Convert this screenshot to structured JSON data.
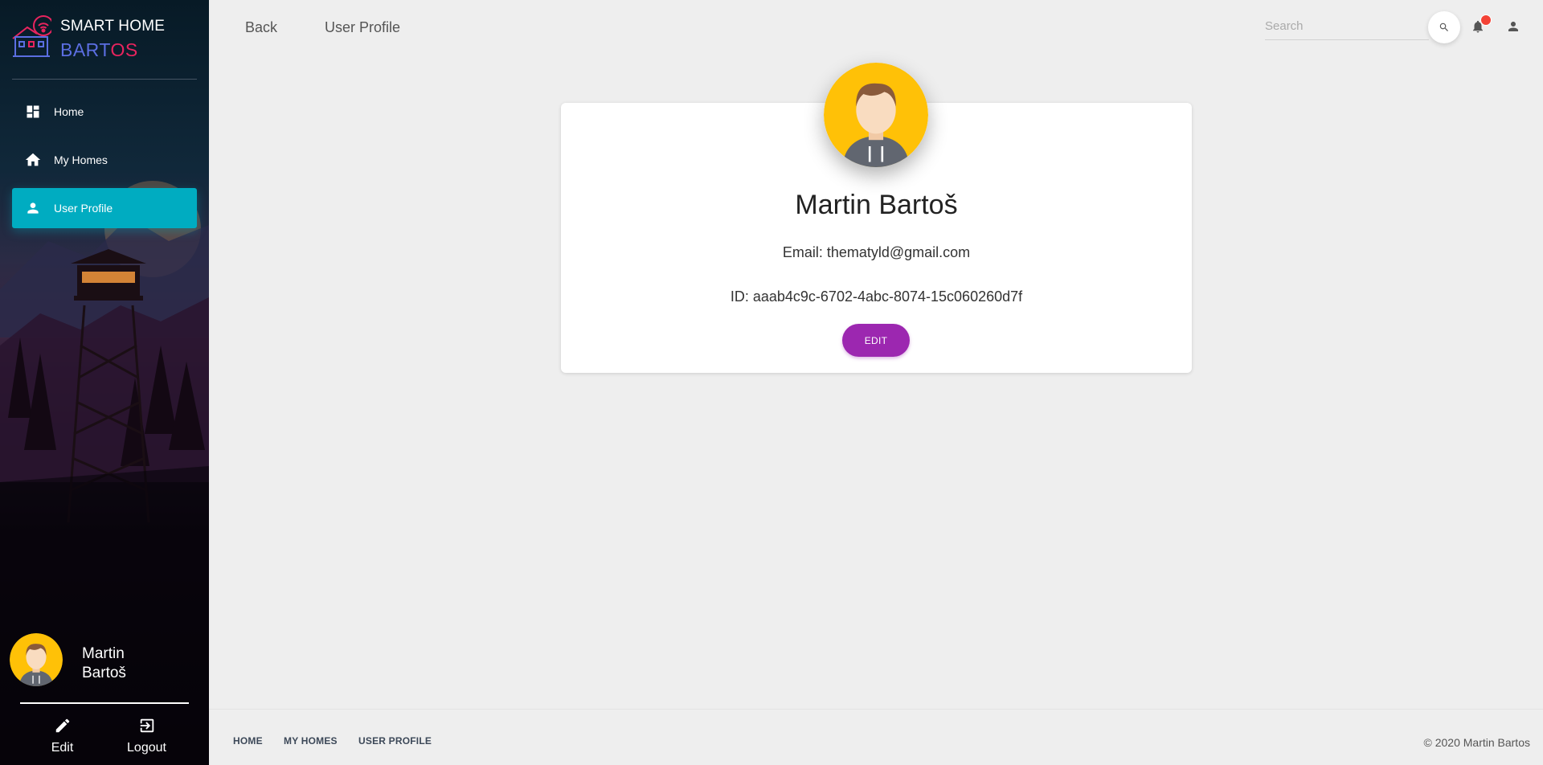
{
  "brand": {
    "line1": "SMART HOME",
    "line2a": "BART",
    "line2b": "OS",
    "logo_icon": "smart-home-logo-icon"
  },
  "sidebar": {
    "items": [
      {
        "label": "Home",
        "icon": "dashboard-icon"
      },
      {
        "label": "My Homes",
        "icon": "home-icon"
      },
      {
        "label": "User Profile",
        "icon": "person-icon",
        "active": true
      }
    ],
    "user": {
      "first": "Martin",
      "last": "Bartoš"
    },
    "actions": [
      {
        "label": "Edit",
        "icon": "pencil-icon"
      },
      {
        "label": "Logout",
        "icon": "logout-icon"
      }
    ],
    "accent": "#00acc1"
  },
  "topbar": {
    "back_label": "Back",
    "page_title": "User Profile",
    "search_placeholder": "Search",
    "notification_color": "#f44336"
  },
  "profile": {
    "name": "Martin Bartoš",
    "email": "Email: thematyld@gmail.com",
    "id": "ID: aaab4c9c-6702-4abc-8074-15c060260d7f",
    "edit_label": "EDIT",
    "button_color": "#9c27b0"
  },
  "footer": {
    "links": [
      "HOME",
      "MY HOMES",
      "USER PROFILE"
    ],
    "copyright": "© 2020 Martin Bartos"
  }
}
